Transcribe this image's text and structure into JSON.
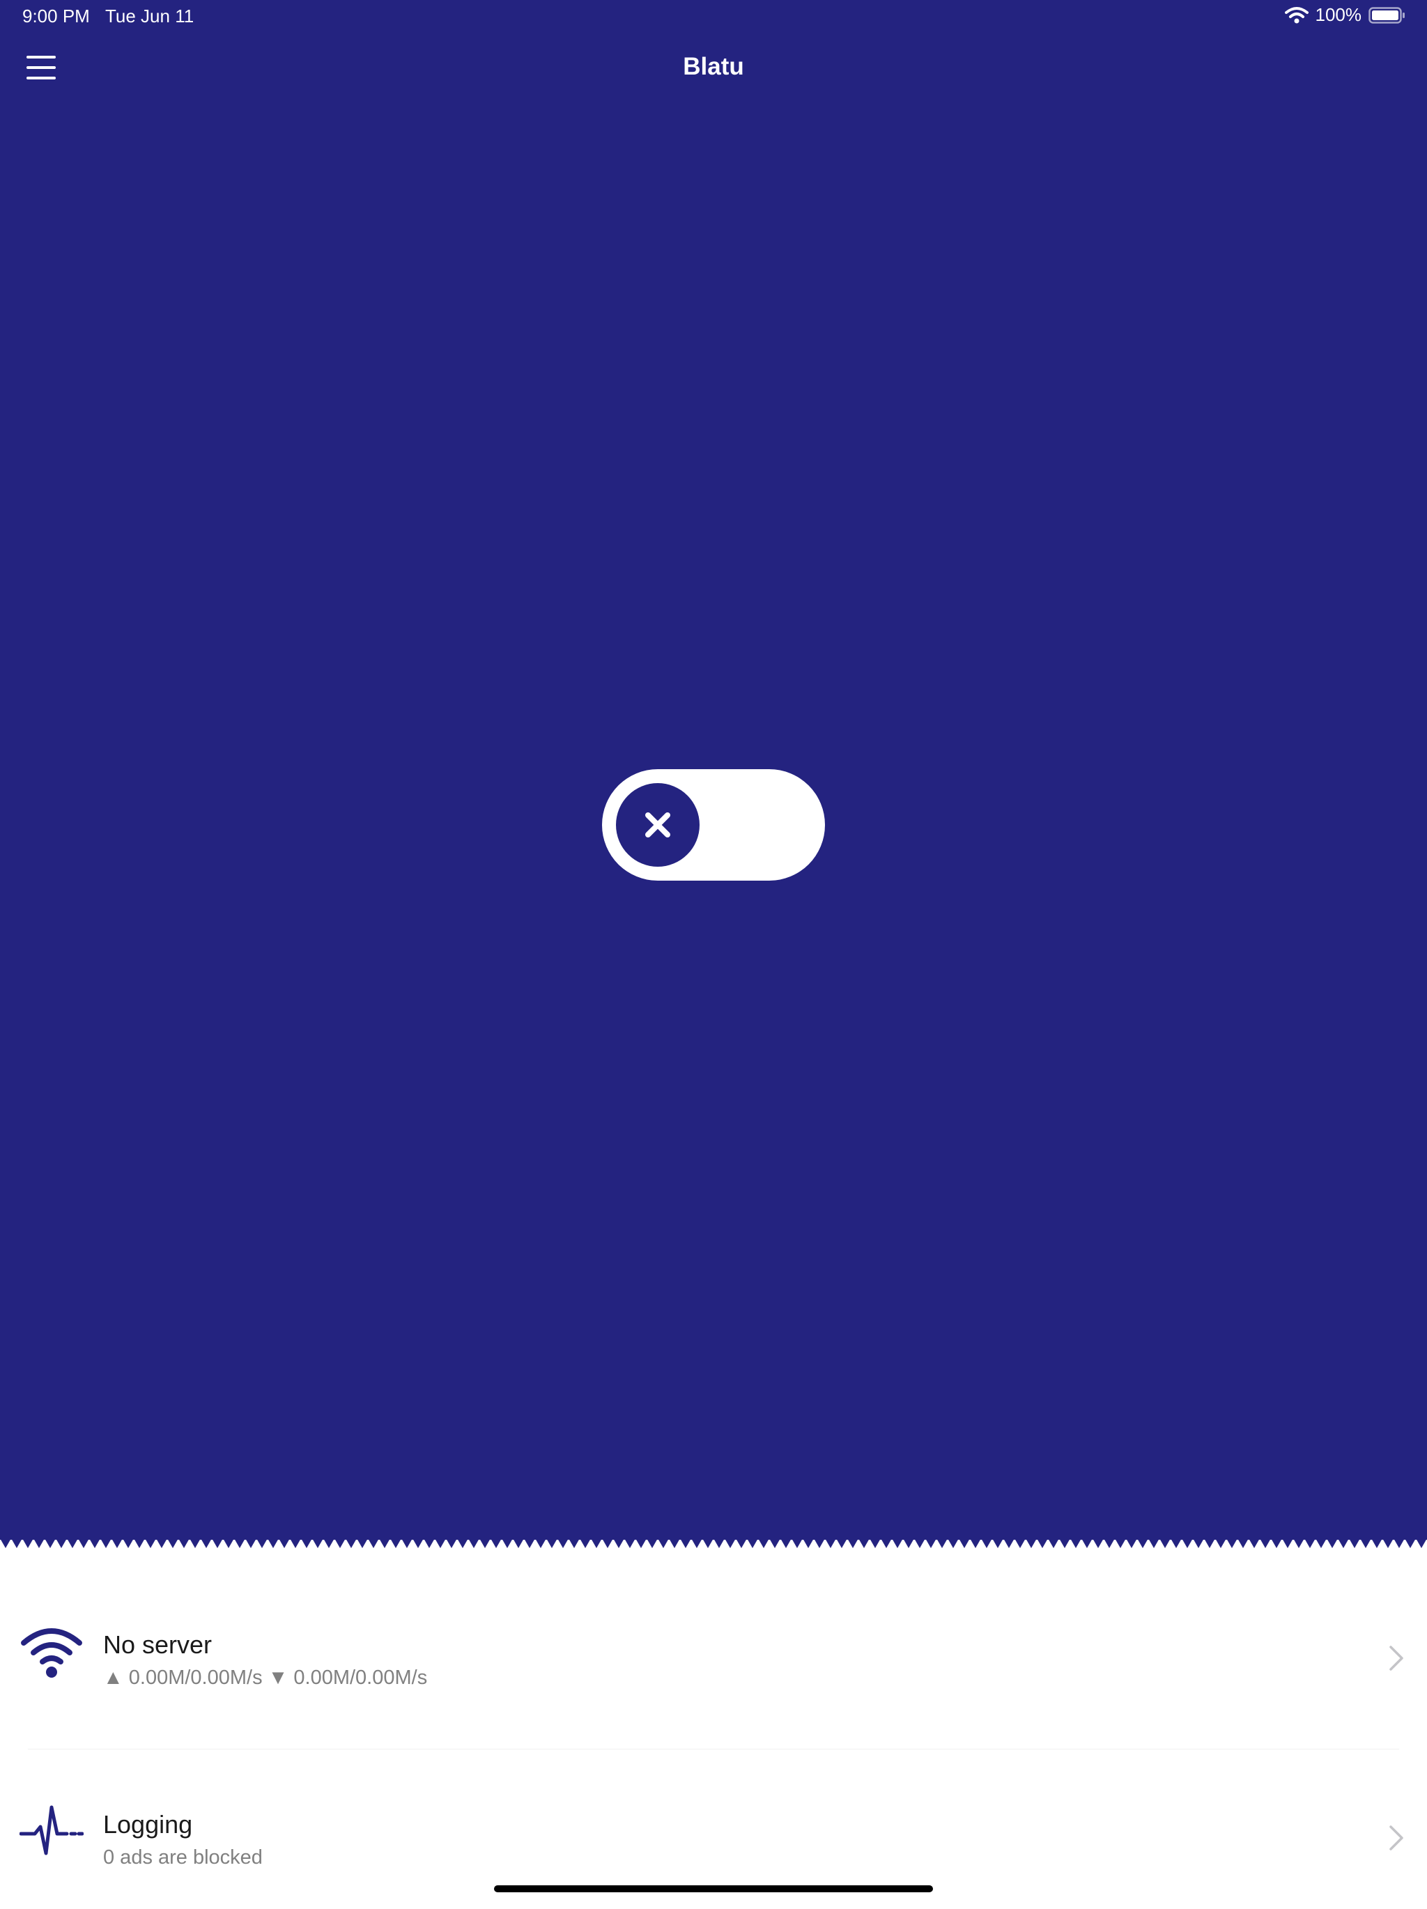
{
  "status_bar": {
    "time": "9:00 PM",
    "date": "Tue Jun 11",
    "battery": "100%"
  },
  "nav": {
    "title": "Blatu"
  },
  "colors": {
    "primary": "#242380",
    "background": "#ffffff",
    "title_text": "#1a1a1a",
    "subtitle_text": "#808080"
  },
  "toggle": {
    "state": "off",
    "icon": "close-icon"
  },
  "rows": [
    {
      "icon": "wifi-icon",
      "title": "No server",
      "subtitle": "▲ 0.00M/0.00M/s ▼ 0.00M/0.00M/s"
    },
    {
      "icon": "pulse-icon",
      "title": "Logging",
      "subtitle": "0 ads are blocked"
    }
  ]
}
